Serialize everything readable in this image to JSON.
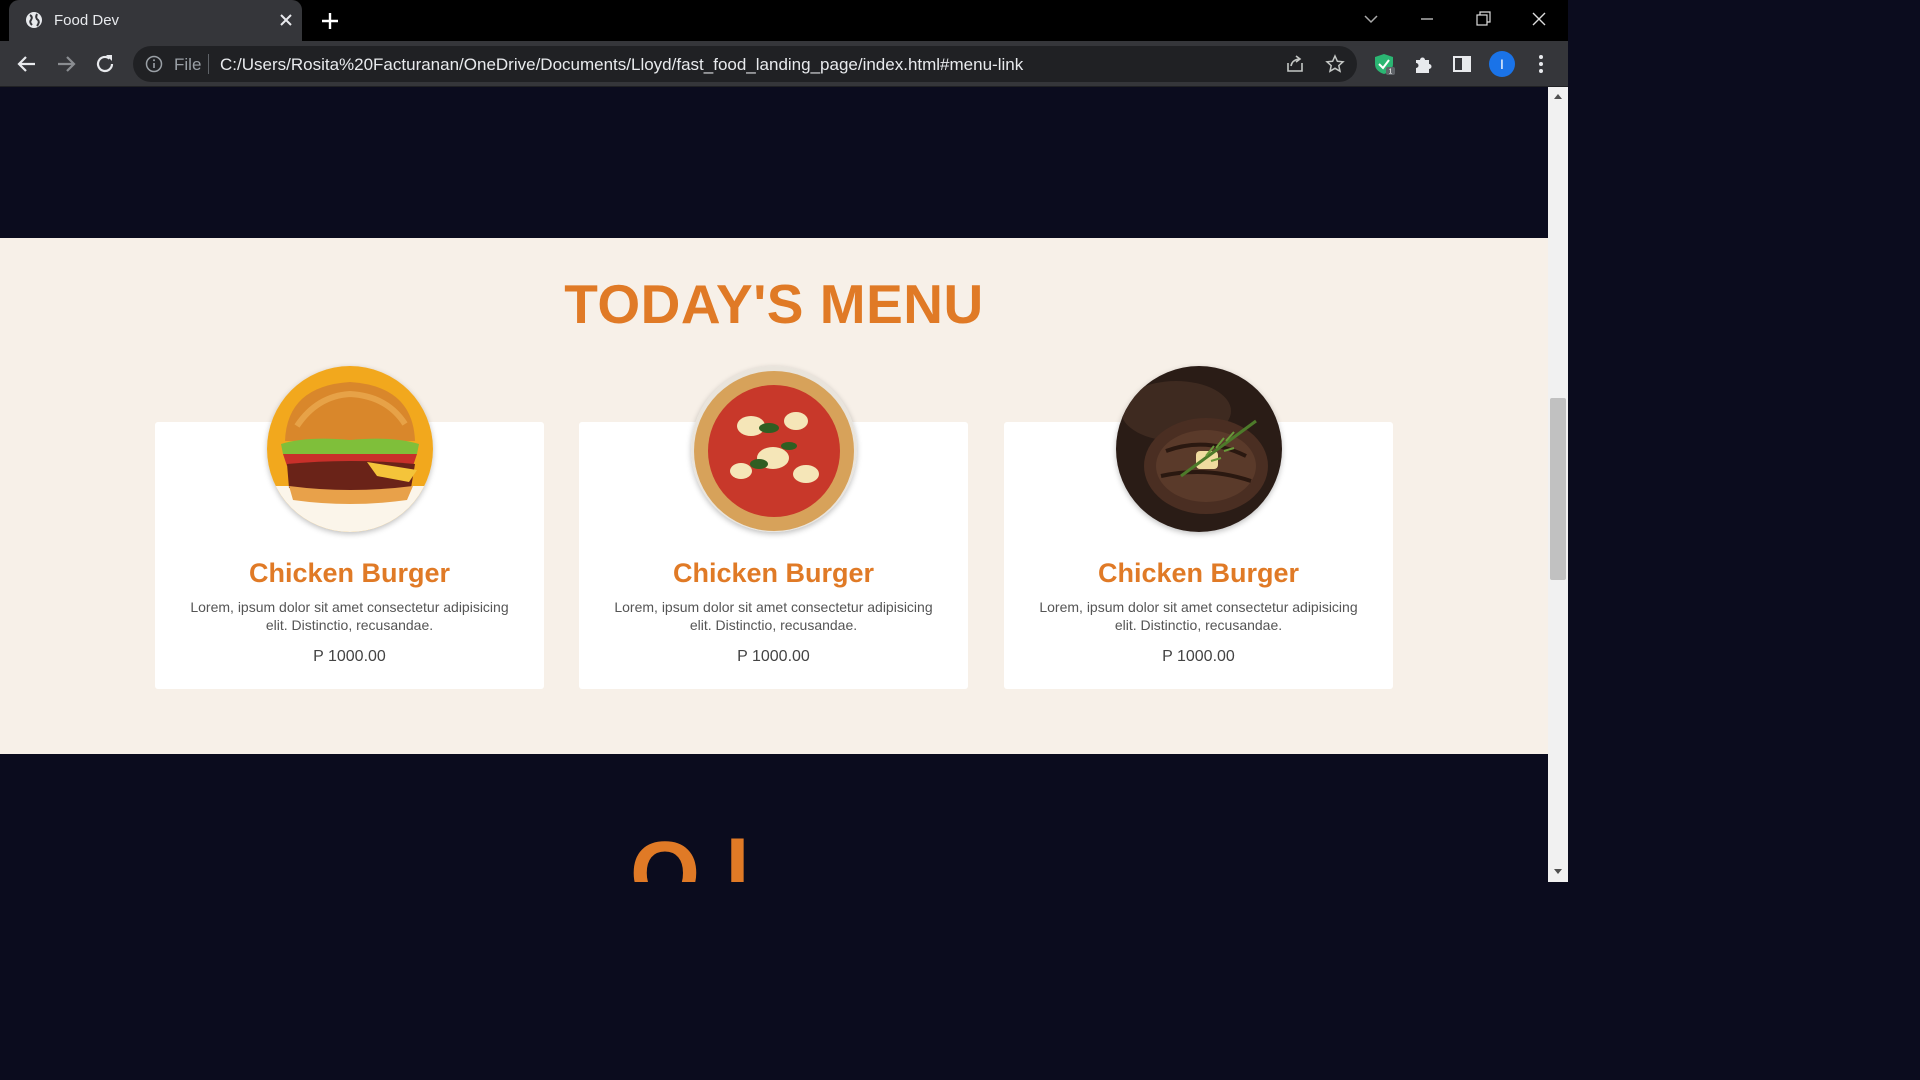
{
  "browser": {
    "tab_title": "Food Dev",
    "url_scheme": "File",
    "url": "C:/Users/Rosita%20Facturanan/OneDrive/Documents/Lloyd/fast_food_landing_page/index.html#menu-link",
    "profile_initial": "I",
    "extension_badge": "1"
  },
  "menu": {
    "title": "TODAY'S MENU",
    "items": [
      {
        "name": "Chicken Burger",
        "description": "Lorem, ipsum dolor sit amet consectetur adipisicing elit. Distinctio, recusandae.",
        "price": "P 1000.00",
        "image": "burger"
      },
      {
        "name": "Chicken Burger",
        "description": "Lorem, ipsum dolor sit amet consectetur adipisicing elit. Distinctio, recusandae.",
        "price": "P 1000.00",
        "image": "pizza"
      },
      {
        "name": "Chicken Burger",
        "description": "Lorem, ipsum dolor sit amet consectetur adipisicing elit. Distinctio, recusandae.",
        "price": "P 1000.00",
        "image": "steak"
      }
    ]
  },
  "next_section": {
    "title_partial": "O        l"
  },
  "colors": {
    "accent": "#e07a26",
    "dark_bg": "#0b0c1e",
    "menu_bg": "#f7f0e8"
  }
}
